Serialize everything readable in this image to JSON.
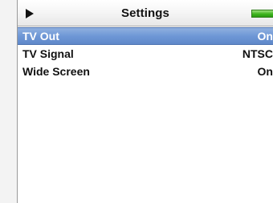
{
  "title_bar": {
    "title": "Settings",
    "play_icon": "play-icon",
    "battery_icon": "battery-icon",
    "battery_color": "#3fb41f"
  },
  "menu": {
    "items": [
      {
        "label": "TV Out",
        "value": "On",
        "selected": true
      },
      {
        "label": "TV Signal",
        "value": "NTSC",
        "selected": false
      },
      {
        "label": "Wide Screen",
        "value": "On",
        "selected": false
      }
    ]
  },
  "colors": {
    "selection": "#6e97d6",
    "text": "#111111",
    "selected_text": "#ffffff"
  }
}
